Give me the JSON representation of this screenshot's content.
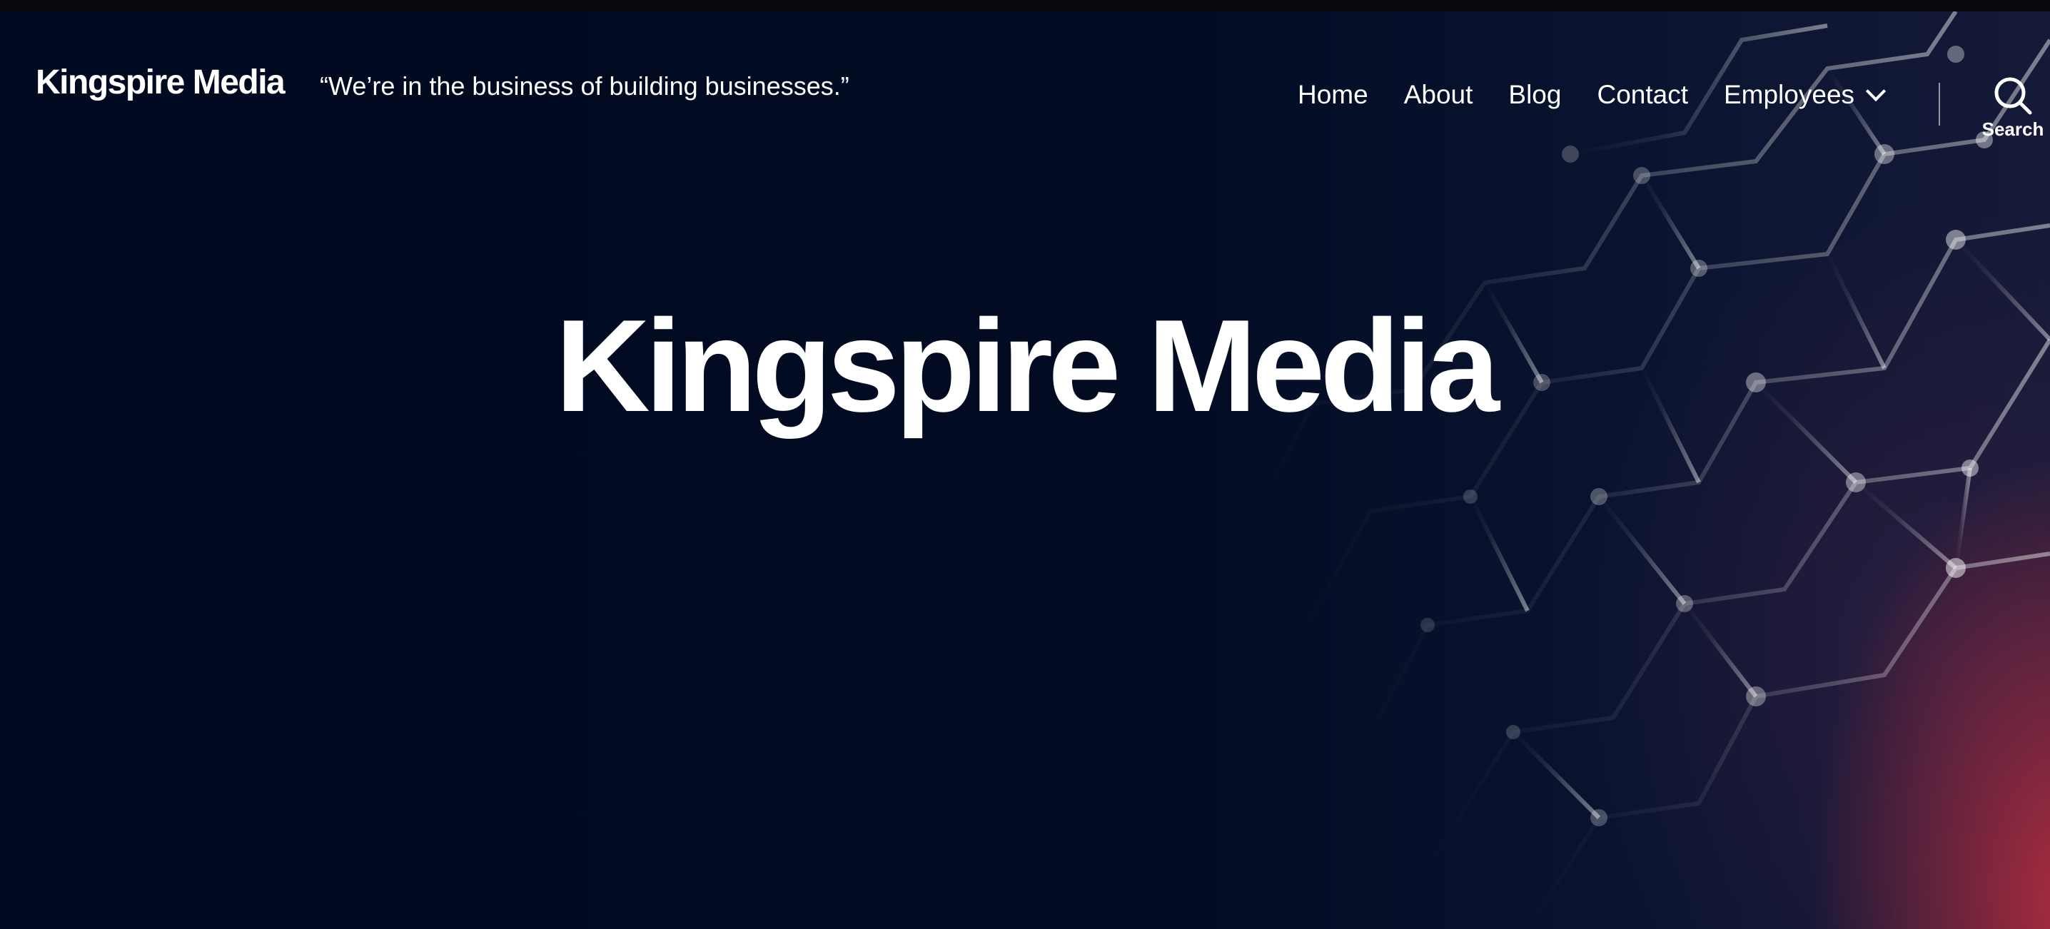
{
  "header": {
    "site_title": "Kingspire Media",
    "tagline": "“We’re in the business of building businesses.”"
  },
  "nav": {
    "items": [
      {
        "label": "Home"
      },
      {
        "label": "About"
      },
      {
        "label": "Blog"
      },
      {
        "label": "Contact"
      },
      {
        "label": "Employees",
        "has_submenu": true
      }
    ]
  },
  "search": {
    "label": "Search",
    "icon": "search-icon"
  },
  "hero": {
    "title": "Kingspire Media"
  },
  "colors": {
    "background": "#020a1f",
    "text": "#ffffff",
    "accent_red": "#c42e3e"
  }
}
